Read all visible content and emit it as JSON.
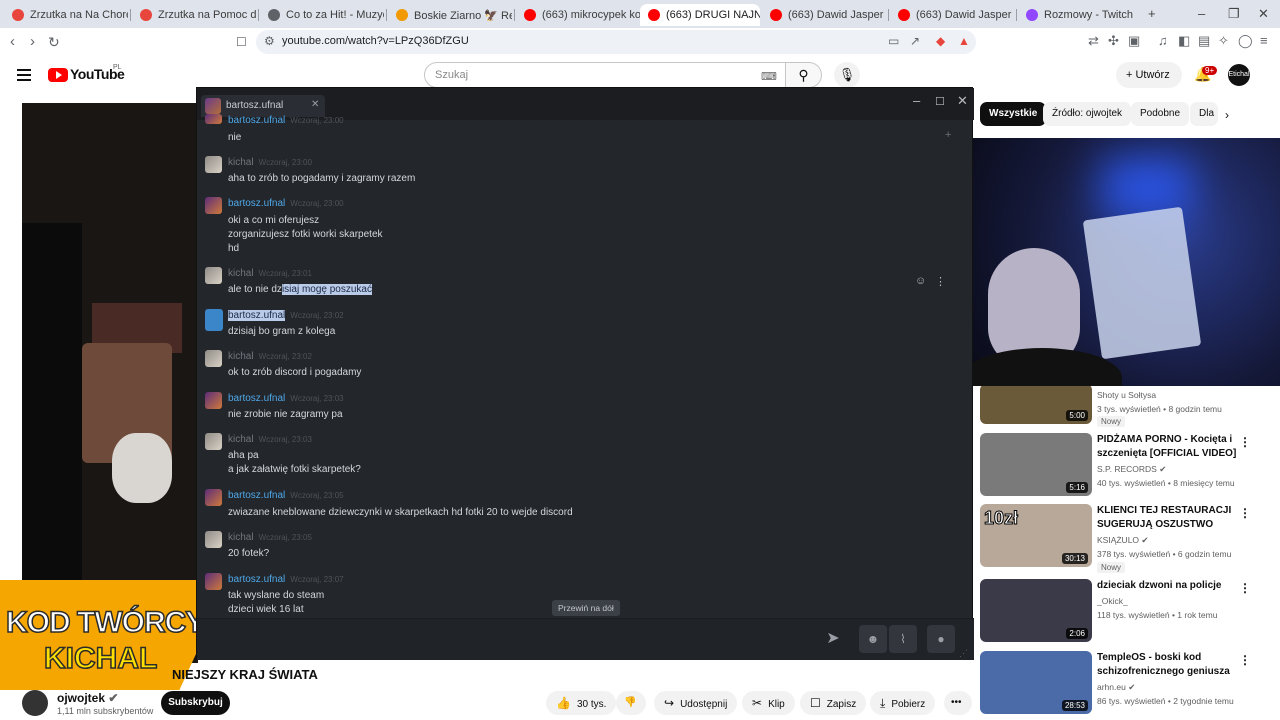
{
  "browser": {
    "tabs": [
      {
        "label": "Zrzutka na Na Chore Osoby",
        "color": "#e8453c"
      },
      {
        "label": "Zrzutka na Pomoc dla Mał",
        "color": "#e8453c"
      },
      {
        "label": "Co to za Hit! - Muzyczny Q",
        "color": "#5f6368"
      },
      {
        "label": "Boskie Ziarno 🦅 Rekordy",
        "color": "#f29900"
      },
      {
        "label": "(663) mikrocypek kotołgo",
        "color": "#ff0000"
      },
      {
        "label": "(663) DRUGI NAJNIEB",
        "color": "#ff0000"
      },
      {
        "label": "(663) Dawid Jasper i mój a",
        "color": "#ff0000"
      },
      {
        "label": "(663) Dawid Jasper - Bicie",
        "color": "#ff0000"
      },
      {
        "label": "Rozmowy - Twitch",
        "color": "#9146ff"
      }
    ],
    "url": "youtube.com/watch?v=LPzQ36DfZGU"
  },
  "youtube": {
    "logo_text": "YouTube",
    "country_code": "PL",
    "search_placeholder": "Szukaj",
    "create_label": "Utwórz",
    "notif_count": "9+",
    "avatar_text": "Etichal"
  },
  "video": {
    "overlay_line1": "KOD TWÓRCY",
    "overlay_line2": "KICHAL",
    "title": "NIEJSZY KRAJ ŚWIATA",
    "channel_name": "ojwojtek",
    "channel_subs": "1,11 mln subskrybentów",
    "subscribe_label": "Subskrybuj",
    "like_count": "30 tys.",
    "share_label": "Udostępnij",
    "clip_label": "Klip",
    "save_label": "Zapisz",
    "download_label": "Pobierz"
  },
  "chips": [
    "Wszystkie",
    "Źródło: ojwojtek",
    "Podobne",
    "Dla"
  ],
  "recommended": [
    {
      "title": "",
      "channel": "Shoty u Sołtysa",
      "meta": "3 tys. wyświetleń • 8 godzin temu",
      "badge": "Nowy",
      "duration": "5:00",
      "thumb": "#6a5a3a"
    },
    {
      "title": "PIDŻAMA PORNO - Kocięta i szczenięta [OFFICIAL VIDEO]",
      "channel": "S.P. RECORDS ✔",
      "meta": "40 tys. wyświetleń • 8 miesięcy temu",
      "badge": "",
      "duration": "5:16",
      "thumb": "#7a7a7a"
    },
    {
      "title": "KLIENCI TEJ RESTAURACJI SUGERUJĄ OSZUSTWO",
      "channel": "KSIĄŻULO ✔",
      "meta": "378 tys. wyświetleń • 6 godzin temu",
      "badge": "Nowy",
      "duration": "30:13",
      "thumb": "#b8a89a",
      "thumb_text": "10zł"
    },
    {
      "title": "dzieciak dzwoni na policje",
      "channel": "_Okick_",
      "meta": "118 tys. wyświetleń • 1 rok temu",
      "badge": "",
      "duration": "2:06",
      "thumb": "#3a3a48"
    },
    {
      "title": "TempleOS - boski kod schizofrenicznego geniusza",
      "channel": "arhn.eu ✔",
      "meta": "86 tys. wyświetleń • 2 tygodnie temu",
      "badge": "",
      "duration": "28:53",
      "thumb": "#4a6aa8"
    }
  ],
  "discord": {
    "tab_name": "bartosz.ufnal",
    "scroll_label": "Przewiń na dół",
    "messages": [
      {
        "user": "bartosz.ufnal",
        "time": "Wczoraj, 23:00",
        "lines": [
          "nie"
        ]
      },
      {
        "user": "kichal",
        "time": "Wczoraj, 23:00",
        "lines": [
          "aha to zrób to pogadamy i zagramy razem"
        ]
      },
      {
        "user": "bartosz.ufnal",
        "time": "Wczoraj, 23:00",
        "lines": [
          "oki a co mi oferujesz",
          "zorganizujesz fotki worki skarpetek",
          "hd"
        ]
      },
      {
        "user": "kichal",
        "time": "Wczoraj, 23:01",
        "lines": [
          "ale to nie dz",
          "isiaj mogę poszukać"
        ]
      },
      {
        "user": "bartosz.ufnal",
        "time": "Wczoraj, 23:02",
        "lines": [
          "dzisiaj bo gram z kolega"
        ]
      },
      {
        "user": "kichal",
        "time": "Wczoraj, 23:02",
        "lines": [
          "ok to zrób discord i pogadamy"
        ]
      },
      {
        "user": "bartosz.ufnal",
        "time": "Wczoraj, 23:03",
        "lines": [
          "nie zrobie nie zagramy pa"
        ]
      },
      {
        "user": "kichal",
        "time": "Wczoraj, 23:03",
        "lines": [
          "aha pa",
          "a jak załatwię fotki skarpetek?"
        ]
      },
      {
        "user": "bartosz.ufnal",
        "time": "Wczoraj, 23:05",
        "lines": [
          "zwiazane kneblowane dziewczynki w skarpetkach hd fotki 20 to wejde discord"
        ]
      },
      {
        "user": "kichal",
        "time": "Wczoraj, 23:05",
        "lines": [
          "20 fotek?"
        ]
      },
      {
        "user": "bartosz.ufnal",
        "time": "Wczoraj, 23:07",
        "lines": [
          "tak wyslane do steam",
          "dzieci wiek 16 lat"
        ]
      }
    ]
  }
}
